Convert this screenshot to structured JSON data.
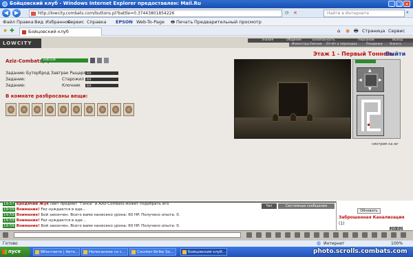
{
  "window": {
    "title": "Бойцовский клуб - Windows Internet Explorer предоставлен: Mail.Ru"
  },
  "browser": {
    "url": "http://lowcity.combats.com/buttons.pl?battle=0.37443801854226",
    "search_placeholder": "Найти в Интернете",
    "menu": [
      "Файл",
      "Правка",
      "Вид",
      "Избранное",
      "Сервис",
      "Справка"
    ],
    "toolbar": [
      "EPSON",
      "Web-To-Page",
      "Печать",
      "Предварительный просмотр"
    ],
    "tab_title": "Бойцовский клуб",
    "cmd": [
      "Страница",
      "Сервис"
    ],
    "status_left": "Готово",
    "status_zone": "Интернет",
    "status_zoom": "100%"
  },
  "game": {
    "logo": "LOWCITY",
    "top_nav": [
      "Знания",
      "Общение",
      "Безопасность",
      "Персонаж",
      "Выход"
    ],
    "sub_nav": [
      "Инвентарь",
      "Умения",
      "Отчёт о переходах",
      "Поединки",
      "Анкета"
    ],
    "player": {
      "name": "Aziz-Combats",
      "level": "[6]",
      "hp": "338/338",
      "hp_fraction": 1.0
    },
    "quests": [
      {
        "label": "Задание:",
        "target": "Бутерброд Завтрак Рыцаря",
        "progress": "0/4"
      },
      {
        "label": "Задание:",
        "target": "Старожил",
        "progress": "0/4"
      },
      {
        "label": "Задание:",
        "target": "Клочник",
        "progress": "0/4"
      }
    ],
    "loot_heading": "В комнате разбросаны вещи:",
    "loot_count": 10,
    "floor_title": "Этаж 1 - Первый Тоннель",
    "exit_label": "Выйти",
    "view_caption": "смотрим на юг"
  },
  "chat": {
    "tab_chat": "Чат",
    "tab_system": "Системные сообщения",
    "lines": [
      {
        "time": "19:57",
        "lead": "Бродячий Жук",
        "text": " свет предмет \"Ганса\" и Aziz-Combats может подобрать его"
      },
      {
        "time": "19:59",
        "lead": "Внимание!",
        "text": " Fez нуждается в еде..."
      },
      {
        "time": "19:59",
        "lead": "Внимание!",
        "text": " Бой закончен. Всего вами нанесено урона: 60 HP. Получено опыта: 0."
      },
      {
        "time": "19:59",
        "lead": "Внимание!",
        "text": " Fez нуждается в еде..."
      },
      {
        "time": "19:59",
        "lead": "Внимание!",
        "text": " Бой закончен. Всего вами нанесено урона: 60 HP. Получено опыта: 0."
      }
    ],
    "refresh_label": "Обновить",
    "location": "Заброшенная Канализация",
    "location_count": "(1)",
    "clock": "20:02"
  },
  "taskbar": {
    "start_label": "пуск",
    "tasks": [
      "ВКонтакте | Автор...",
      "Написанное со смо...",
      "Counter-Strike Source",
      "Бойцовский клуб - ..."
    ],
    "watermark": "photo.scrolls.combats.com"
  }
}
